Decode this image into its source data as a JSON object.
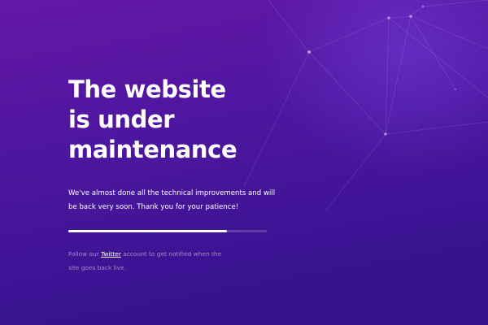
{
  "headline": {
    "line1": "The website",
    "line2": "is under",
    "line3": "maintenance"
  },
  "description": "We've almost done all the technical improvements and will be back very soon. Thank you for your patience!",
  "progress": {
    "fraction": 0.8
  },
  "notify": {
    "prefix": "Follow our ",
    "link_label": "Twitter",
    "suffix": " account to get notified when the site goes back live."
  },
  "colors": {
    "background_top": "#6417a6",
    "background_bottom": "#35118a",
    "text": "#ffffff"
  }
}
